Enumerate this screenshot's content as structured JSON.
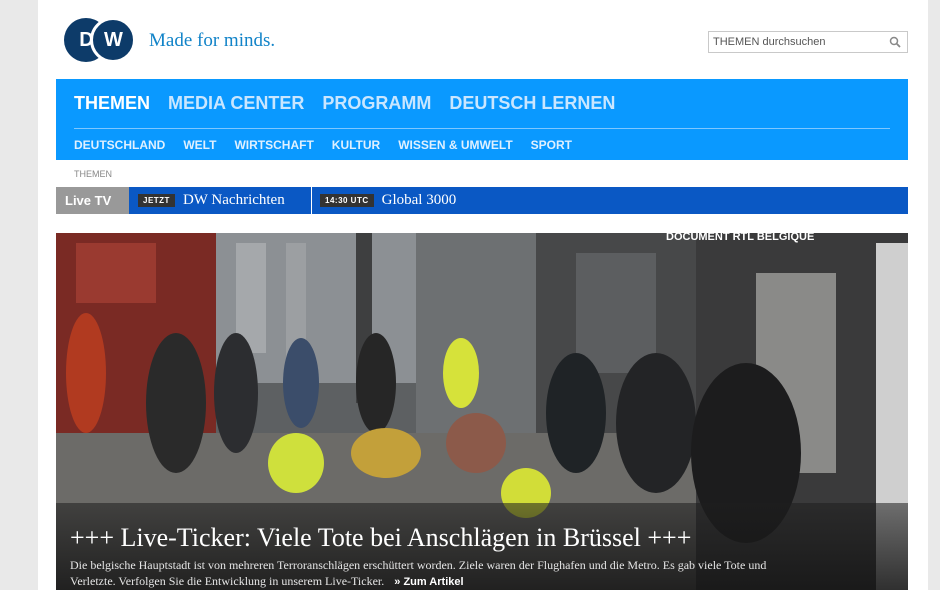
{
  "brand": {
    "logo_text": "DW",
    "tagline": "Made for minds."
  },
  "search": {
    "placeholder": "THEMEN durchsuchen"
  },
  "nav": {
    "main": [
      "THEMEN",
      "MEDIA CENTER",
      "PROGRAMM",
      "DEUTSCH LERNEN"
    ],
    "sub": [
      "DEUTSCHLAND",
      "WELT",
      "WIRTSCHAFT",
      "KULTUR",
      "WISSEN & UMWELT",
      "SPORT"
    ]
  },
  "breadcrumb": "THEMEN",
  "livetv": {
    "label": "Live TV",
    "items": [
      {
        "badge": "JETZT",
        "title": "DW Nachrichten"
      },
      {
        "badge": "14:30 UTC",
        "title": "Global 3000"
      }
    ]
  },
  "hero": {
    "watermark": "DOCUMENT RTL BELGIQUE",
    "title": "+++ Live-Ticker: Viele Tote bei Anschlägen in Brüssel +++",
    "text": "Die belgische Hauptstadt ist von mehreren Terroranschlägen erschüttert worden. Ziele waren der Flughafen und die Metro. Es gab viele Tote und Verletzte. Verfolgen Sie die Entwicklung in unserem Live-Ticker.",
    "link": "» Zum Artikel"
  },
  "colors": {
    "nav_blue": "#0a99ff",
    "live_blue": "#0a58c4",
    "brand_navy": "#0d3b69",
    "tagline_blue": "#1183c8"
  }
}
